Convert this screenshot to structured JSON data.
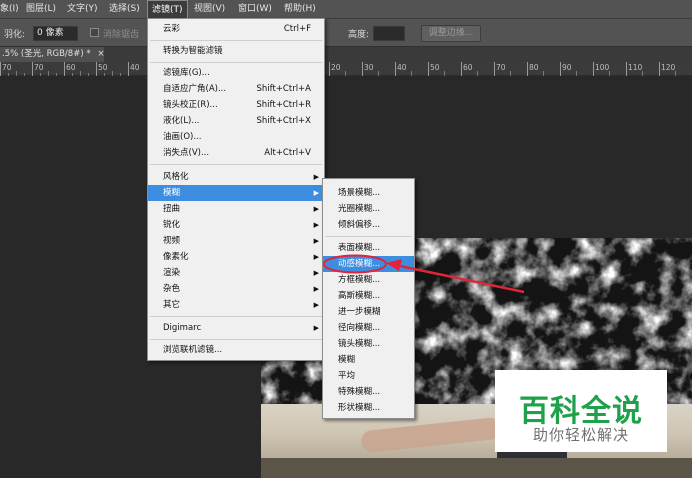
{
  "menubar": {
    "items": [
      "象(I)",
      "图层(L)",
      "文字(Y)",
      "选择(S)",
      "滤镜(T)",
      "视图(V)",
      "窗口(W)",
      "帮助(H)"
    ],
    "active_index": 4
  },
  "options": {
    "feather_label": "羽化:",
    "feather_value": "0 像素",
    "antialias_label": "消除锯齿",
    "height_label": "高度:",
    "refine_edge": "调整边缘..."
  },
  "document_tab": {
    "label": ".5% (圣光, RGB/8#) *",
    "close": "×"
  },
  "ruler": {
    "left_ticks": [
      "70",
      "70",
      "60",
      "50",
      "40"
    ],
    "right_ticks": [
      "20",
      "30",
      "40",
      "50",
      "60",
      "70",
      "80",
      "90",
      "100",
      "110",
      "120"
    ]
  },
  "filter_menu": {
    "items": [
      {
        "label": "云彩",
        "shortcut": "Ctrl+F"
      },
      {
        "label": "转换为智能滤镜",
        "shortcut": ""
      },
      {
        "label": "滤镜库(G)...",
        "shortcut": ""
      },
      {
        "label": "自适应广角(A)...",
        "shortcut": "Shift+Ctrl+A"
      },
      {
        "label": "镜头校正(R)...",
        "shortcut": "Shift+Ctrl+R"
      },
      {
        "label": "液化(L)...",
        "shortcut": "Shift+Ctrl+X"
      },
      {
        "label": "油画(O)...",
        "shortcut": ""
      },
      {
        "label": "消失点(V)...",
        "shortcut": "Alt+Ctrl+V"
      },
      {
        "label": "风格化",
        "shortcut": ""
      },
      {
        "label": "模糊",
        "shortcut": ""
      },
      {
        "label": "扭曲",
        "shortcut": ""
      },
      {
        "label": "锐化",
        "shortcut": ""
      },
      {
        "label": "视频",
        "shortcut": ""
      },
      {
        "label": "像素化",
        "shortcut": ""
      },
      {
        "label": "渲染",
        "shortcut": ""
      },
      {
        "label": "杂色",
        "shortcut": ""
      },
      {
        "label": "其它",
        "shortcut": ""
      },
      {
        "label": "Digimarc",
        "shortcut": ""
      },
      {
        "label": "浏览联机滤镜...",
        "shortcut": ""
      }
    ],
    "highlighted": "模糊"
  },
  "blur_submenu": {
    "items": [
      "场景模糊...",
      "光圈模糊...",
      "倾斜偏移...",
      "表面模糊...",
      "动感模糊...",
      "方框模糊...",
      "高斯模糊...",
      "进一步模糊",
      "径向模糊...",
      "镜头模糊...",
      "模糊",
      "平均",
      "特殊模糊...",
      "形状模糊..."
    ],
    "highlighted": "动感模糊..."
  },
  "watermark": {
    "title": "百科全说",
    "subtitle": "助你轻松解决"
  },
  "colors": {
    "highlight": "#3d8ee0",
    "annotation": "#e0253a",
    "watermark_green": "#1fa04a",
    "ui_panel": "#535353"
  },
  "icons": [
    "chevron-right-icon",
    "close-icon"
  ]
}
